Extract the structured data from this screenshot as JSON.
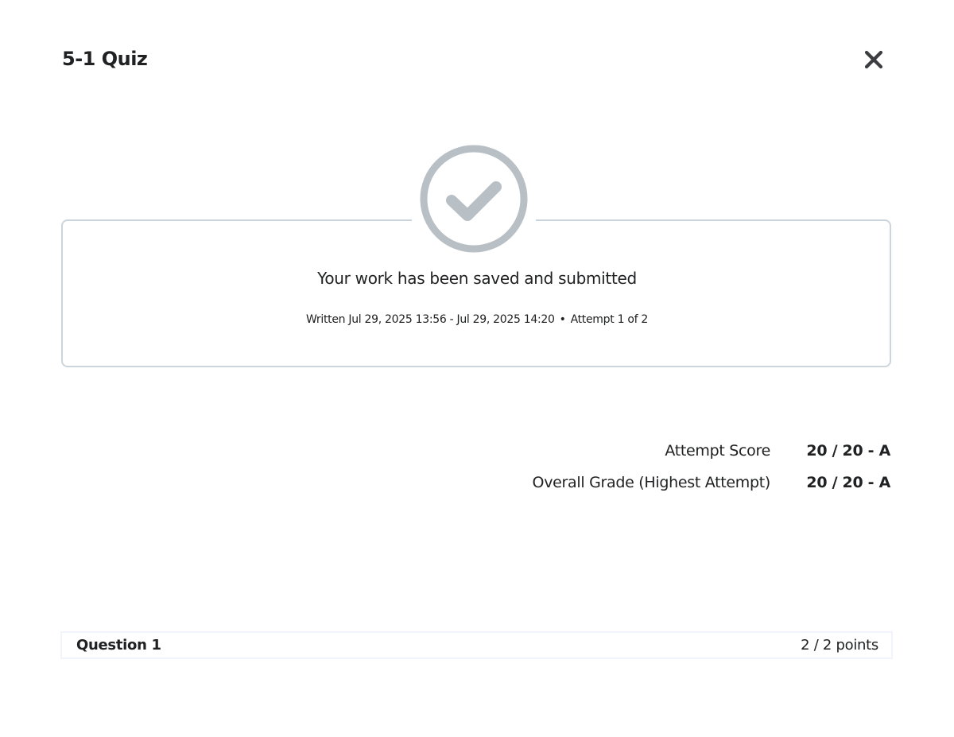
{
  "dialog": {
    "title": "5-1 Quiz",
    "close_icon": "close-icon"
  },
  "submission": {
    "status_icon": "check-circle-icon",
    "message": "Your work has been saved and submitted",
    "written": "Written Jul 29, 2025 13:56 - Jul 29, 2025 14:20",
    "separator": "•",
    "attempt": "Attempt 1 of 2"
  },
  "scores": {
    "attempt_label": "Attempt Score",
    "attempt_value": "20 / 20 - A",
    "overall_label": "Overall Grade (Highest Attempt)",
    "overall_value": "20 / 20 - A"
  },
  "question": {
    "title": "Question 1",
    "points": "2 / 2 points"
  },
  "colors": {
    "icon_gray": "#b8bfc5",
    "border": "#cdd5dc",
    "text": "#202122"
  }
}
